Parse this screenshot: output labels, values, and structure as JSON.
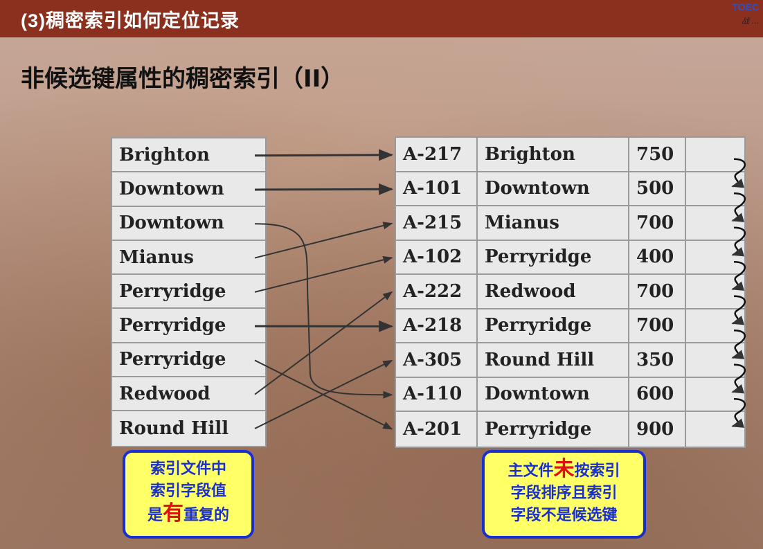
{
  "header": {
    "section_title": "(3)稠密索引如何定位记录",
    "logo_text": "TOEC",
    "logo_sub": "战 ..."
  },
  "slide": {
    "title": "非候选键属性的稠密索引（II）"
  },
  "index_file": {
    "entries": [
      "Brighton",
      "Downtown",
      "Downtown",
      "Mianus",
      "Perryridge",
      "Perryridge",
      "Perryridge",
      "Redwood",
      "Round Hill"
    ]
  },
  "main_file": {
    "records": [
      {
        "account": "A-217",
        "branch": "Brighton",
        "amount": "750"
      },
      {
        "account": "A-101",
        "branch": "Downtown",
        "amount": "500"
      },
      {
        "account": "A-215",
        "branch": "Mianus",
        "amount": "700"
      },
      {
        "account": "A-102",
        "branch": "Perryridge",
        "amount": "400"
      },
      {
        "account": "A-222",
        "branch": "Redwood",
        "amount": "700"
      },
      {
        "account": "A-218",
        "branch": "Perryridge",
        "amount": "700"
      },
      {
        "account": "A-305",
        "branch": "Round Hill",
        "amount": "350"
      },
      {
        "account": "A-110",
        "branch": "Downtown",
        "amount": "600"
      },
      {
        "account": "A-201",
        "branch": "Perryridge",
        "amount": "900"
      }
    ]
  },
  "pointer_map": [
    0,
    1,
    7,
    2,
    3,
    5,
    8,
    4,
    6
  ],
  "callouts": {
    "left": {
      "line1": "索引文件中",
      "line2": "索引字段值",
      "line3_pre": "是",
      "line3_em": "有",
      "line3_post": "重复的"
    },
    "right": {
      "line1_pre": "主文件",
      "line1_em": "未",
      "line1_post": "按索引",
      "line2": "字段排序且索引",
      "line3": "字段不是候选键"
    }
  },
  "colors": {
    "header_bar": "#8b2f1f",
    "callout_fill": "#ffff66",
    "callout_border": "#1a2fd0",
    "emphasis": "#e01010"
  }
}
